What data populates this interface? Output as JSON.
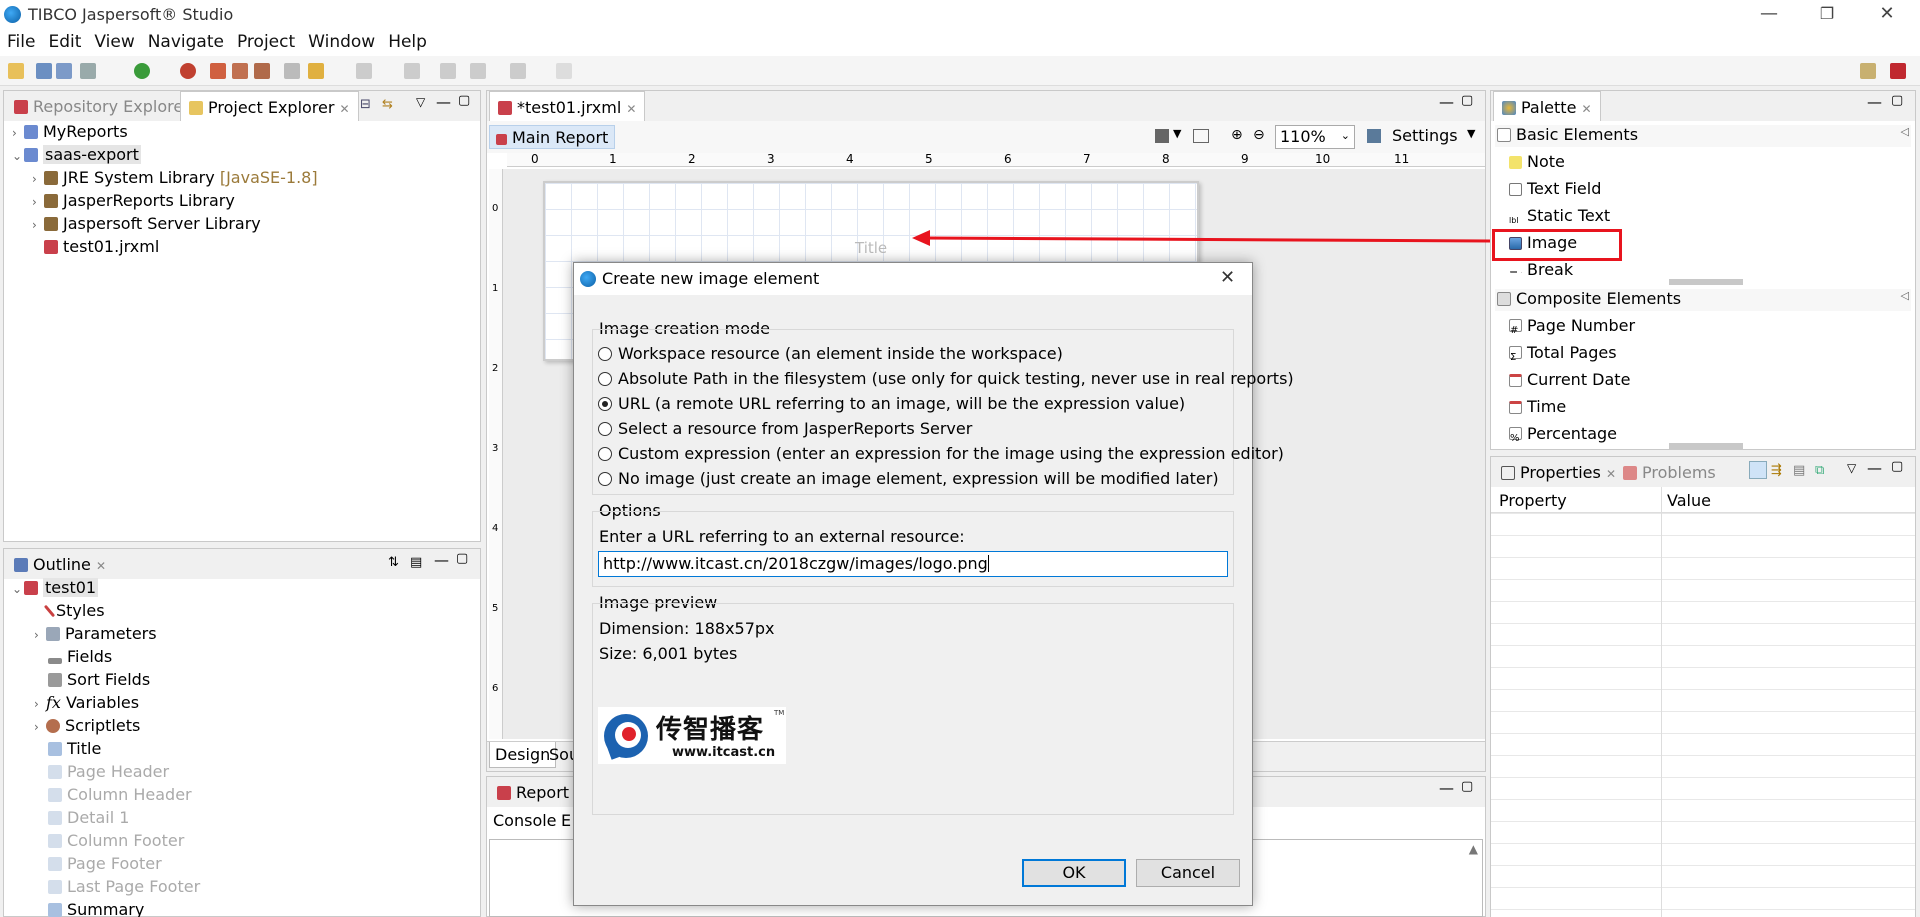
{
  "window": {
    "title": "TIBCO Jaspersoft® Studio",
    "minimize_glyph": "—",
    "restore_glyph": "❐",
    "close_glyph": "✕"
  },
  "menu": [
    "File",
    "Edit",
    "View",
    "Navigate",
    "Project",
    "Window",
    "Help"
  ],
  "left_top_panel": {
    "tabs": [
      {
        "label": "Repository Explorer",
        "active": false
      },
      {
        "label": "Project Explorer",
        "active": true
      }
    ],
    "tree": [
      {
        "label": "MyReports",
        "expanded": false
      },
      {
        "label": "saas-export",
        "expanded": true
      },
      {
        "label": "JRE System Library",
        "suffix": "[JavaSE-1.8]"
      },
      {
        "label": "JasperReports Library"
      },
      {
        "label": "Jaspersoft Server Library"
      },
      {
        "label": "test01.jrxml"
      }
    ]
  },
  "outline_panel": {
    "tab": "Outline",
    "items": [
      {
        "label": "test01",
        "enabled": true
      },
      {
        "label": "Styles",
        "enabled": true
      },
      {
        "label": "Parameters",
        "enabled": true
      },
      {
        "label": "Fields",
        "enabled": true
      },
      {
        "label": "Sort Fields",
        "enabled": true
      },
      {
        "label": "Variables",
        "enabled": true
      },
      {
        "label": "Scriptlets",
        "enabled": true
      },
      {
        "label": "Title",
        "enabled": true
      },
      {
        "label": "Page Header",
        "enabled": false
      },
      {
        "label": "Column Header",
        "enabled": false
      },
      {
        "label": "Detail 1",
        "enabled": false
      },
      {
        "label": "Column Footer",
        "enabled": false
      },
      {
        "label": "Page Footer",
        "enabled": false
      },
      {
        "label": "Last Page Footer",
        "enabled": false
      },
      {
        "label": "Summary",
        "enabled": true
      }
    ]
  },
  "editor": {
    "tab": "*test01.jrxml",
    "sub_tab": "Main Report",
    "zoom": "110%",
    "settings_label": "Settings",
    "ruler_numbers": [
      "0",
      "1",
      "2",
      "3",
      "4",
      "5",
      "6",
      "7",
      "8",
      "9",
      "10",
      "11"
    ],
    "vertical_ruler_numbers": [
      "0",
      "1",
      "2",
      "3",
      "4",
      "5",
      "6"
    ],
    "canvas_band_label": "Title",
    "bottom_tabs": [
      "Design",
      "Sou"
    ]
  },
  "report_state_panel": {
    "tab": "Report S",
    "console_tabs": [
      "Console",
      "E"
    ]
  },
  "palette": {
    "tab": "Palette",
    "basic_header": "Basic Elements",
    "basic_items": [
      "Note",
      "Text Field",
      "Static Text",
      "Image",
      "Break"
    ],
    "composite_header": "Composite Elements",
    "composite_items": [
      "Page Number",
      "Total Pages",
      "Current Date",
      "Time",
      "Percentage"
    ],
    "highlight_color": "#e8141e"
  },
  "properties": {
    "tabs": [
      "Properties",
      "Problems"
    ],
    "columns": [
      "Property",
      "Value"
    ]
  },
  "dialog": {
    "title": "Create new image element",
    "mode_group_label": "Image creation mode",
    "modes": [
      {
        "label": "Workspace resource (an element inside the workspace)",
        "checked": false
      },
      {
        "label": "Absolute Path in the filesystem (use only for quick testing, never use in real reports)",
        "checked": false
      },
      {
        "label": "URL (a remote URL referring to an image, will be the expression value)",
        "checked": true
      },
      {
        "label": "Select a resource from JasperReports Server",
        "checked": false
      },
      {
        "label": "Custom expression (enter an expression for the image using the expression editor)",
        "checked": false
      },
      {
        "label": "No image (just create an image element, expression will be modified later)",
        "checked": false
      }
    ],
    "options_label": "Options",
    "url_prompt": "Enter a URL referring to an external resource:",
    "url_value": "http://www.itcast.cn/2018czgw/images/logo.png",
    "preview_label": "Image preview",
    "dimension": "Dimension: 188x57px",
    "size": "Size: 6,001 bytes",
    "logo_text": "传智播客",
    "logo_tm": "TM",
    "logo_url": "www.itcast.cn",
    "ok_label": "OK",
    "cancel_label": "Cancel"
  },
  "colors": {
    "accent_blue": "#0078d7",
    "selection": "#cce8ff",
    "annotation_red": "#e8141e"
  }
}
